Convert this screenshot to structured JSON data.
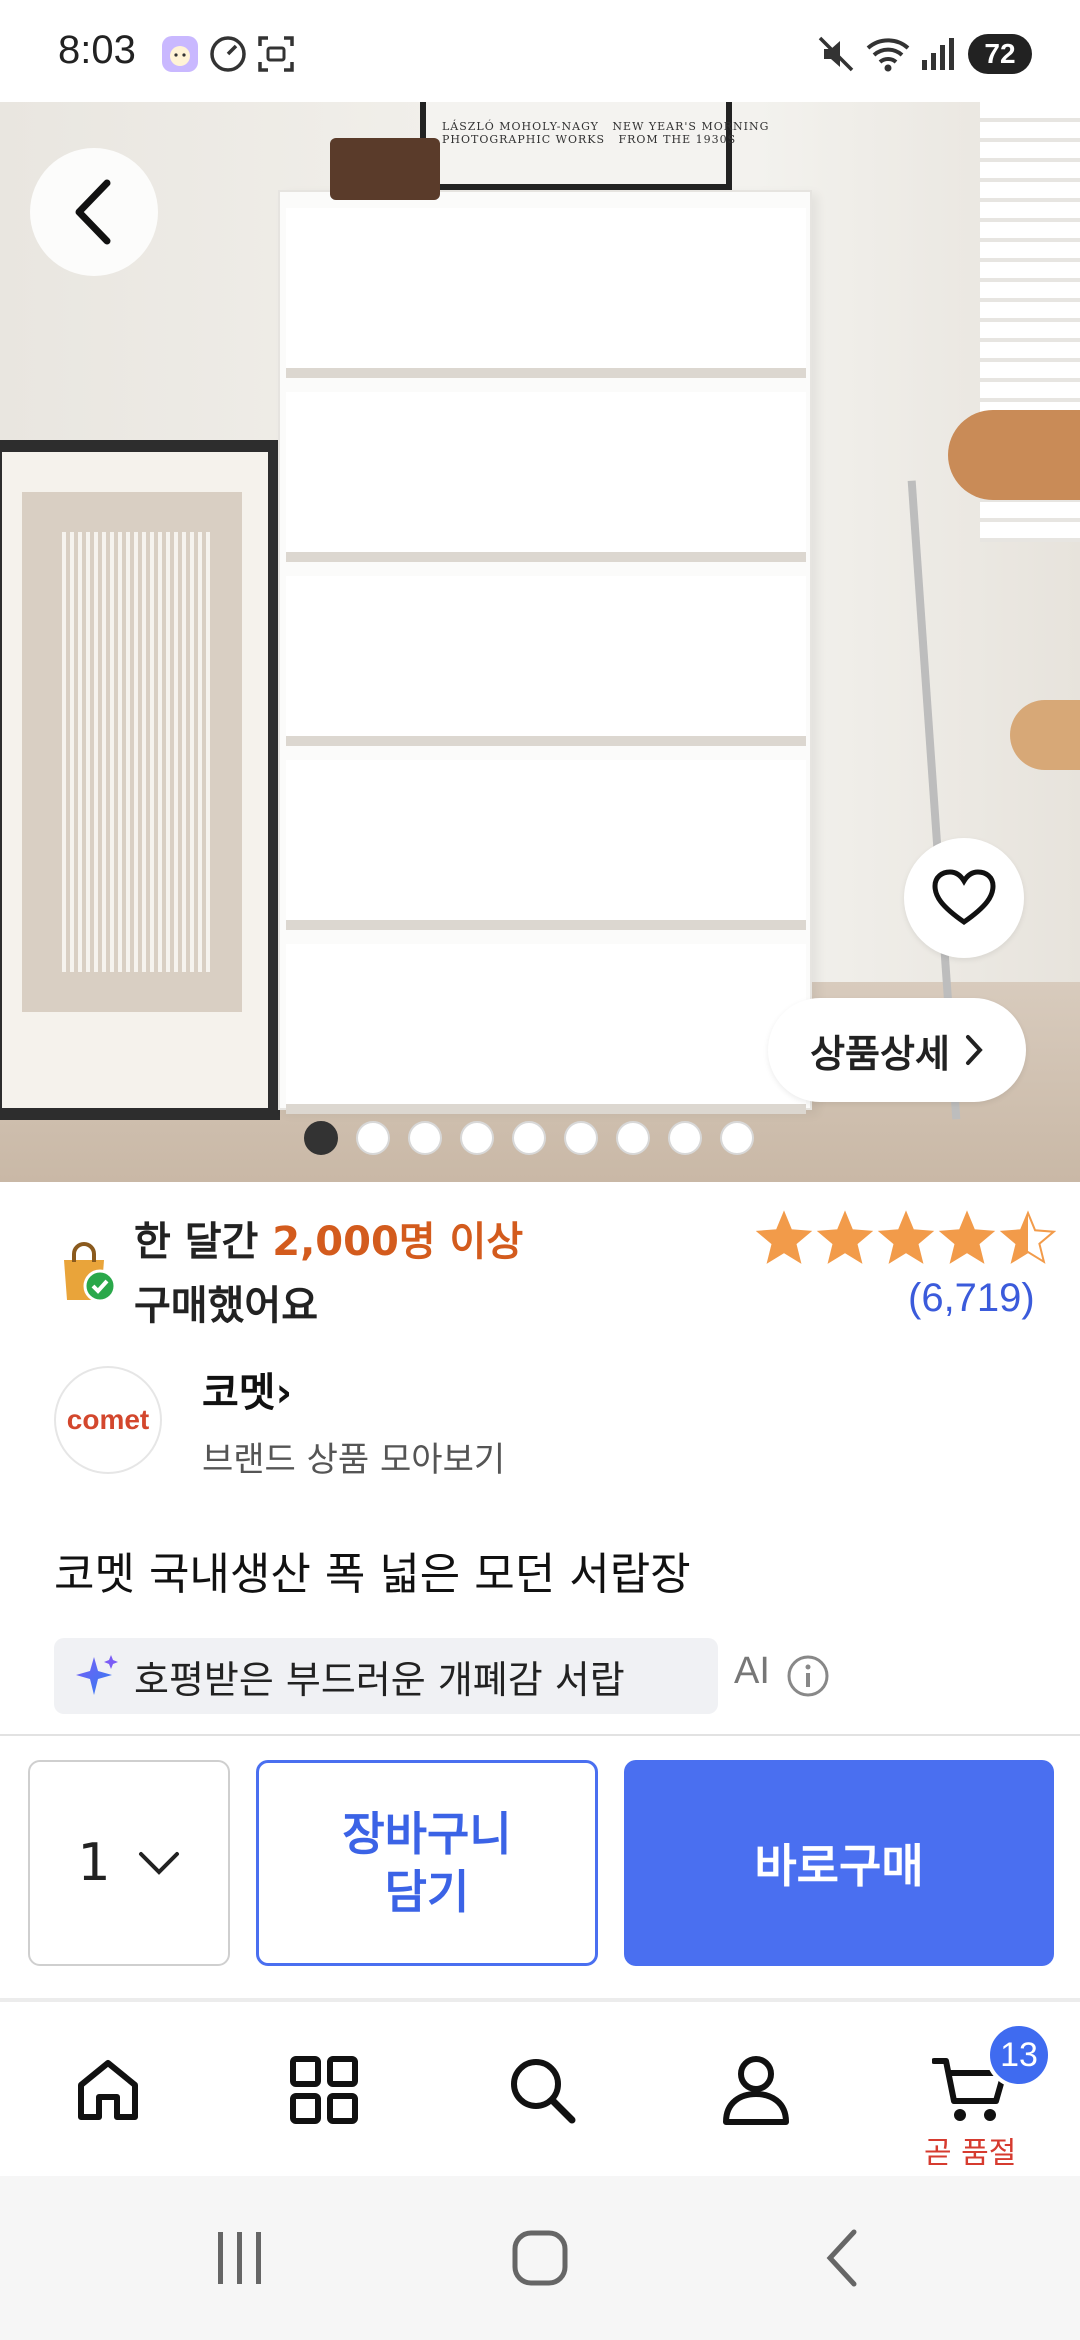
{
  "status_bar": {
    "time": "8:03",
    "battery": "72",
    "icons": [
      "avatar-icon",
      "speedometer-icon",
      "screenshot-icon",
      "mute-icon",
      "wifi-icon",
      "signal-icon"
    ]
  },
  "hero": {
    "poster_caption": "LÁSZLÓ MOHOLY-NAGY   NEW YEAR'S MORNING\nPHOTOGRAPHIC WORKS   FROM THE 1930S",
    "detail_button": "상품상세",
    "page_dots": {
      "total": 9,
      "active": 0
    }
  },
  "purchase_info": {
    "prefix": "한 달간 ",
    "highlight": "2,000명 이상",
    "line2": "구매했어요",
    "rating": 4.5,
    "review_count": "(6,719)"
  },
  "brand": {
    "logo_text": "comet",
    "name": "코멧",
    "link": "브랜드 상품 모아보기"
  },
  "product": {
    "title": "코멧 국내생산 폭 넓은 모던 서랍장",
    "ai_summary": "호평받은 부드러운 개폐감 서랍",
    "ai_label": "AI"
  },
  "actions": {
    "quantity": "1",
    "cart_line1": "장바구니",
    "cart_line2": "담기",
    "buy_now": "바로구매"
  },
  "bottom_nav": {
    "items": [
      "home-icon",
      "categories-icon",
      "search-icon",
      "profile-icon",
      "cart-icon"
    ],
    "cart_badge": "13",
    "cart_note": "곧 품절"
  },
  "colors": {
    "accent": "#4a6ff0",
    "highlight": "#d35b1d",
    "star": "#f29b4a",
    "badge": "#3f6bf0",
    "soldout": "#d63b2f"
  }
}
